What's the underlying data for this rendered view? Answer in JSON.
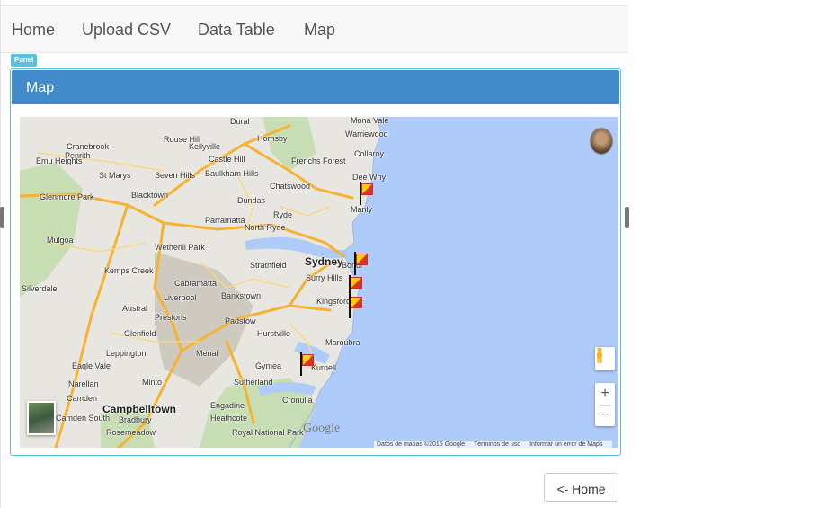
{
  "nav": {
    "items": [
      {
        "label": "Home"
      },
      {
        "label": "Upload CSV"
      },
      {
        "label": "Data Table"
      },
      {
        "label": "Map"
      }
    ]
  },
  "panel": {
    "tag": "Panel",
    "title": "Map"
  },
  "map": {
    "places": {
      "mona_vale": "Mona Vale",
      "warriewood": "Warriewood",
      "collaroy": "Collaroy",
      "dee_why": "Dee Why",
      "manly": "Manly",
      "sydney": "Sydney",
      "surry_hills": "Surry Hills",
      "kingsford": "Kingsford",
      "maroubra": "Maroubra",
      "cronulla": "Cronulla",
      "kurnell": "Kurnell",
      "chatswood": "Chatswood",
      "castle_hill": "Castle Hill",
      "hornsby": "Hornsby",
      "parramatta": "Parramatta",
      "blacktown": "Blacktown",
      "strathfield": "Strathfield",
      "bankstown": "Bankstown",
      "liverpool": "Liverpool",
      "hurstville": "Hurstville",
      "sutherland": "Sutherland",
      "campbelltown": "Campbelltown",
      "camden_south": "Camden South",
      "penrith": "Penrith",
      "st_marys": "St Marys",
      "glenmore_park": "Glenmore Park",
      "kemps_creek": "Kemps Creek",
      "silverdale": "Silverdale",
      "mulgoa": "Mulgoa",
      "menai": "Menai",
      "padstow": "Padstow",
      "ryde": "Ryde",
      "rouse_hill": "Rouse Hill",
      "glenfield": "Glenfield",
      "camden": "Camden",
      "heathcote": "Heathcote",
      "dural": "Dural",
      "dundas": "Dundas",
      "seven_hills": "Seven Hills",
      "wetherill_park": "Wetherill Park",
      "prestons": "Prestons",
      "austral": "Austral",
      "minto": "Minto",
      "bradbury": "Bradbury",
      "rosemeadow": "Rosemeadow",
      "frenchs_forest": "Frenchs Forest",
      "north_ryde": "North Ryde",
      "bondi": "Bondi",
      "cabramatta": "Cabramatta",
      "leppington": "Leppington",
      "eagle_vale": "Eagle Vale",
      "narellan": "Narellan",
      "kellyville": "Kellyville",
      "baulkham_hills": "Baulkham Hills",
      "gymea": "Gymea",
      "engadine": "Engadine",
      "royal_national_park": "Royal National Park",
      "cranebrook": "Cranebrook",
      "emu_heights": "Emu Heights"
    },
    "attribution": {
      "data": "Datos de mapas ©2015 Google",
      "terms": "Términos de uso",
      "report": "Informar un error de Maps"
    },
    "google_logo": "Google",
    "zoom_in": "+",
    "zoom_out": "−"
  },
  "home_button": "<- Home",
  "colors": {
    "accent": "#428bca",
    "panel_border": "#5bc0de",
    "water": "#aecbfa",
    "land": "#e8e6e0",
    "park": "#c7ddb3",
    "road": "#f5b331"
  }
}
